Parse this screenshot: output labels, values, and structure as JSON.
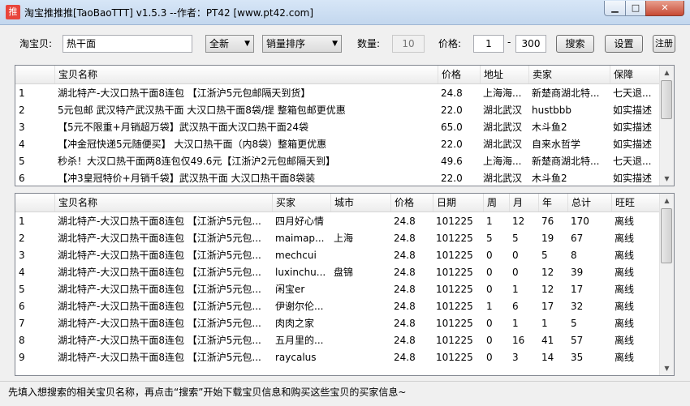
{
  "window": {
    "title": "淘宝推推推[TaoBaoTTT] v1.5.3 --作者：PT42 [www.pt42.com]",
    "icon_text": "推",
    "min_glyph": "▁",
    "max_glyph": "□",
    "close_glyph": "✕"
  },
  "toolbar": {
    "keyword_label": "淘宝贝:",
    "keyword_value": "热干面",
    "condition_value": "全新",
    "sort_value": "销量排序",
    "count_label": "数量:",
    "count_value": "10",
    "price_label": "价格:",
    "price_min": "1",
    "price_sep": "-",
    "price_max": "300",
    "search_label": "搜索",
    "settings_label": "设置",
    "register_label": "注册"
  },
  "products": {
    "columns": [
      "",
      "宝贝名称",
      "价格",
      "地址",
      "卖家",
      "保障"
    ],
    "rows": [
      [
        "1",
        "湖北特产-大汉口热干面8连包 【江浙沪5元包邮隔天到货】",
        "24.8",
        "上海海...",
        "新楚商湖北特...",
        "七天退..."
      ],
      [
        "2",
        "5元包邮 武汉特产武汉热干面 大汉口热干面8袋/提 整箱包邮更优惠",
        "22.0",
        "湖北武汉",
        "hustbbb",
        "如实描述"
      ],
      [
        "3",
        "【5元不限重+月销超万袋】武汉热干面大汉口热干面24袋",
        "65.0",
        "湖北武汉",
        "木斗鱼2",
        "如实描述"
      ],
      [
        "4",
        "【冲金冠快递5元随便买】 大汉口热干面（内8袋）整箱更优惠",
        "22.0",
        "湖北武汉",
        "自来水哲学",
        "如实描述"
      ],
      [
        "5",
        "秒杀！大汉口热干面两8连包仅49.6元【江浙沪2元包邮隔天到】",
        "49.6",
        "上海海...",
        "新楚商湖北特...",
        "七天退..."
      ],
      [
        "6",
        "【冲3皇冠特价+月销千袋】武汉热干面 大汉口热干面8袋装",
        "22.0",
        "湖北武汉",
        "木斗鱼2",
        "如实描述"
      ]
    ]
  },
  "buyers": {
    "columns": [
      "",
      "宝贝名称",
      "买家",
      "城市",
      "价格",
      "日期",
      "周",
      "月",
      "年",
      "总计",
      "旺旺"
    ],
    "rows": [
      [
        "1",
        "湖北特产-大汉口热干面8连包 【江浙沪5元包...",
        "四月好心情",
        "",
        "24.8",
        "101225",
        "1",
        "12",
        "76",
        "170",
        "离线"
      ],
      [
        "2",
        "湖北特产-大汉口热干面8连包 【江浙沪5元包...",
        "maimap...",
        "上海",
        "24.8",
        "101225",
        "5",
        "5",
        "19",
        "67",
        "离线"
      ],
      [
        "3",
        "湖北特产-大汉口热干面8连包 【江浙沪5元包...",
        "mechcui",
        "",
        "24.8",
        "101225",
        "0",
        "0",
        "5",
        "8",
        "离线"
      ],
      [
        "4",
        "湖北特产-大汉口热干面8连包 【江浙沪5元包...",
        "luxinchu...",
        "盘锦",
        "24.8",
        "101225",
        "0",
        "0",
        "12",
        "39",
        "离线"
      ],
      [
        "5",
        "湖北特产-大汉口热干面8连包 【江浙沪5元包...",
        "闲宝er",
        "",
        "24.8",
        "101225",
        "0",
        "1",
        "12",
        "17",
        "离线"
      ],
      [
        "6",
        "湖北特产-大汉口热干面8连包 【江浙沪5元包...",
        "伊谢尔伦...",
        "",
        "24.8",
        "101225",
        "1",
        "6",
        "17",
        "32",
        "离线"
      ],
      [
        "7",
        "湖北特产-大汉口热干面8连包 【江浙沪5元包...",
        "肉肉之家",
        "",
        "24.8",
        "101225",
        "0",
        "1",
        "1",
        "5",
        "离线"
      ],
      [
        "8",
        "湖北特产-大汉口热干面8连包 【江浙沪5元包...",
        "五月里的...",
        "",
        "24.8",
        "101225",
        "0",
        "16",
        "41",
        "57",
        "离线"
      ],
      [
        "9",
        "湖北特产-大汉口热干面8连包 【江浙沪5元包...",
        "raycalus",
        "",
        "24.8",
        "101225",
        "0",
        "3",
        "14",
        "35",
        "离线"
      ]
    ]
  },
  "status": {
    "text": "先填入想搜索的相关宝贝名称，再点击“搜索”开始下载宝贝信息和购买这些宝贝的买家信息~"
  }
}
